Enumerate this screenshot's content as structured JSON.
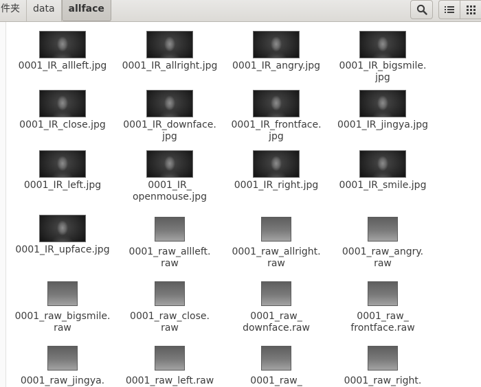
{
  "breadcrumbs": [
    "件夹",
    "data",
    "allface"
  ],
  "toolbar": {
    "search_icon": "search-icon",
    "list_view_icon": "list-view-icon",
    "grid_view_icon": "grid-view-icon"
  },
  "files": [
    {
      "name": "0001_IR_allleft.jpg",
      "kind": "photo"
    },
    {
      "name": "0001_IR_allright.jpg",
      "kind": "photo"
    },
    {
      "name": "0001_IR_angry.jpg",
      "kind": "photo"
    },
    {
      "name": "0001_IR_bigsmile.\njpg",
      "kind": "photo"
    },
    {
      "name": "0001_IR_close.jpg",
      "kind": "photo"
    },
    {
      "name": "0001_IR_downface.\njpg",
      "kind": "photo"
    },
    {
      "name": "0001_IR_frontface.\njpg",
      "kind": "photo"
    },
    {
      "name": "0001_IR_jingya.jpg",
      "kind": "photo"
    },
    {
      "name": "0001_IR_left.jpg",
      "kind": "photo"
    },
    {
      "name": "0001_IR_\nopenmouse.jpg",
      "kind": "photo"
    },
    {
      "name": "0001_IR_right.jpg",
      "kind": "photo"
    },
    {
      "name": "0001_IR_smile.jpg",
      "kind": "photo"
    },
    {
      "name": "0001_IR_upface.jpg",
      "kind": "photo"
    },
    {
      "name": "0001_raw_allleft.\nraw",
      "kind": "raw"
    },
    {
      "name": "0001_raw_allright.\nraw",
      "kind": "raw"
    },
    {
      "name": "0001_raw_angry.\nraw",
      "kind": "raw"
    },
    {
      "name": "0001_raw_bigsmile.\nraw",
      "kind": "raw"
    },
    {
      "name": "0001_raw_close.\nraw",
      "kind": "raw"
    },
    {
      "name": "0001_raw_\ndownface.raw",
      "kind": "raw"
    },
    {
      "name": "0001_raw_\nfrontface.raw",
      "kind": "raw"
    },
    {
      "name": "0001_raw_jingya.",
      "kind": "raw"
    },
    {
      "name": "0001_raw_left.raw",
      "kind": "raw"
    },
    {
      "name": "0001_raw_",
      "kind": "raw"
    },
    {
      "name": "0001_raw_right.",
      "kind": "raw"
    }
  ]
}
